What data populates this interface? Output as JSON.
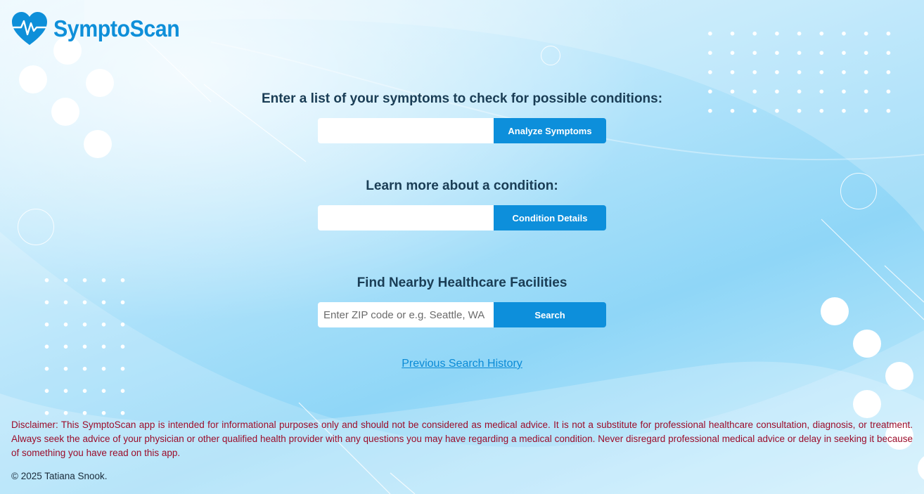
{
  "header": {
    "logo_text": "SymptoScan",
    "logo_icon": "heart-pulse-icon",
    "accent_color": "#0e8fd9"
  },
  "symptoms": {
    "title": "Enter a list of your symptoms to check for possible conditions:",
    "input_value": "",
    "input_placeholder": "",
    "button_label": "Analyze Symptoms"
  },
  "condition": {
    "title": "Learn more about a condition:",
    "input_value": "",
    "input_placeholder": "",
    "button_label": "Condition Details"
  },
  "facilities": {
    "title": "Find Nearby Healthcare Facilities",
    "input_value": "",
    "input_placeholder": "Enter ZIP code or e.g. Seattle, WA",
    "button_label": "Search"
  },
  "history_link": "Previous Search History",
  "footer": {
    "disclaimer": "Disclaimer: This SymptoScan app is intended for informational purposes only and should not be considered as medical advice. It is not a substitute for professional healthcare consultation, diagnosis, or treatment. Always seek the advice of your physician or other qualified health provider with any questions you may have regarding a medical condition. Never disregard professional medical advice or delay in seeking it because of something you have read on this app.",
    "copyright": "© 2025 Tatiana Snook."
  },
  "colors": {
    "button": "#0d8fdb",
    "title_text": "#1a3d55",
    "disclaimer_text": "#9b0c2a",
    "link": "#0a8ad6"
  }
}
